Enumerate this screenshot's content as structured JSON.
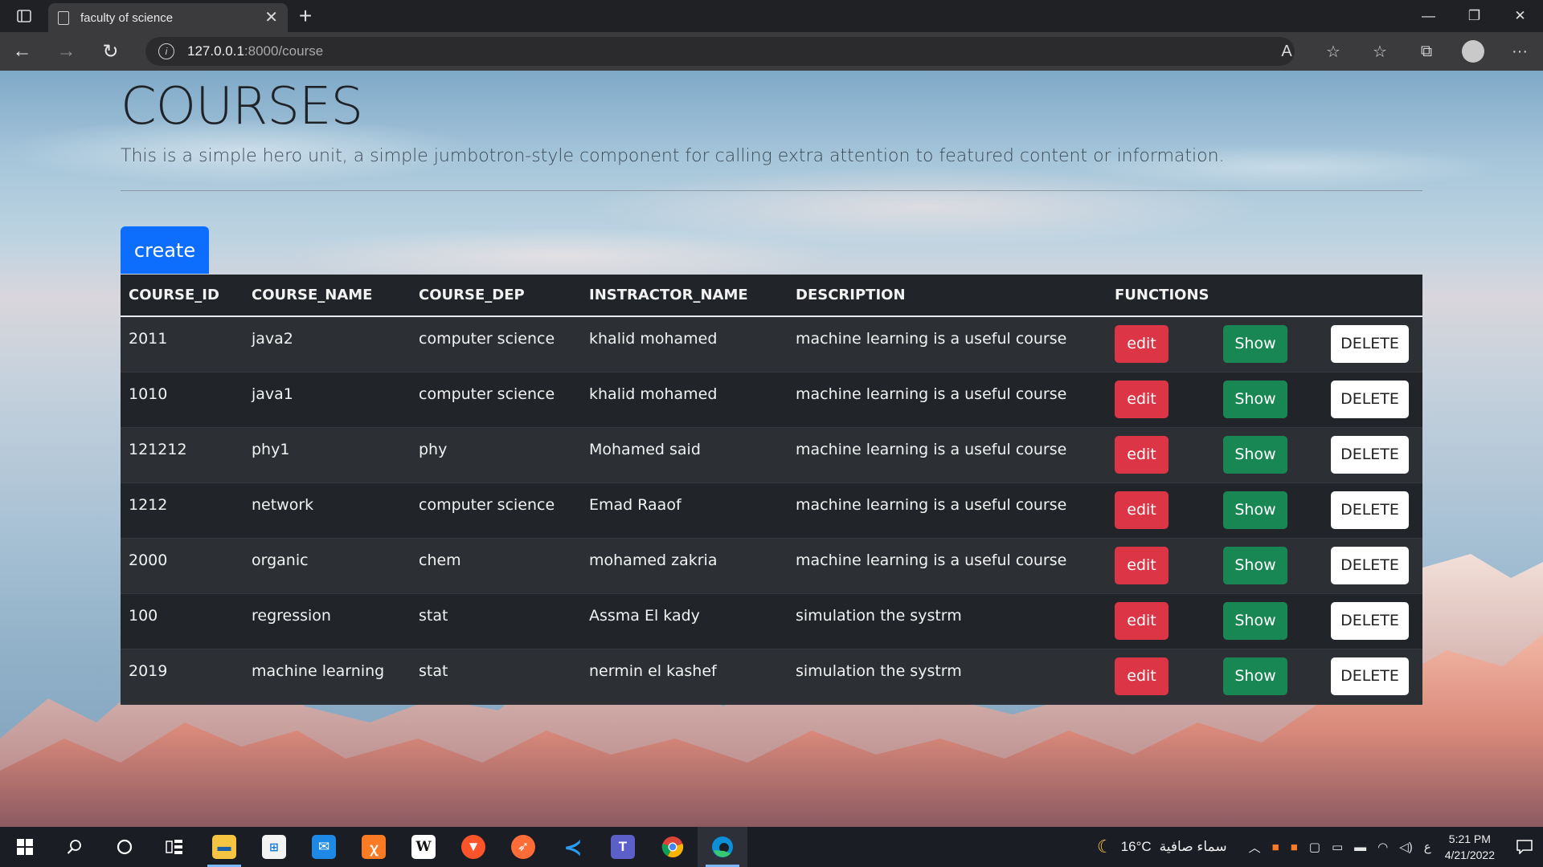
{
  "browser": {
    "tab_title": "faculty of science",
    "new_tab_label": "+",
    "url_host": "127.0.0.1",
    "url_port_path": ":8000/course",
    "window_controls": {
      "minimize": "—",
      "restore": "❐",
      "close": "✕"
    },
    "nav": {
      "back": "←",
      "forward": "→",
      "reload": "↻"
    },
    "toolbar_icons": {
      "read_aloud": "A",
      "favorite_add": "☆",
      "favorites": "☆",
      "collections": "⧉",
      "more": "···"
    }
  },
  "hero": {
    "title": "COURSES",
    "lead": "This is a simple hero unit, a simple jumbotron-style component for calling extra attention to featured content or information."
  },
  "create_label": "create",
  "table": {
    "headers": [
      "COURSE_ID",
      "COURSE_NAME",
      "COURSE_DEP",
      "INSTRACTOR_NAME",
      "DESCRIPTION",
      "FUNCTIONS"
    ],
    "edit_label": "edit",
    "show_label": "Show",
    "delete_label": "DELETE",
    "rows": [
      {
        "id": "2011",
        "name": "java2",
        "dep": "computer science",
        "instructor": "khalid mohamed",
        "description": "machine learning is a useful course"
      },
      {
        "id": "1010",
        "name": "java1",
        "dep": "computer science",
        "instructor": "khalid mohamed",
        "description": "machine learning is a useful course"
      },
      {
        "id": "121212",
        "name": "phy1",
        "dep": "phy",
        "instructor": "Mohamed said",
        "description": "machine learning is a useful course"
      },
      {
        "id": "1212",
        "name": "network",
        "dep": "computer science",
        "instructor": "Emad Raaof",
        "description": "machine learning is a useful course"
      },
      {
        "id": "2000",
        "name": "organic",
        "dep": "chem",
        "instructor": "mohamed zakria",
        "description": "machine learning is a useful course"
      },
      {
        "id": "100",
        "name": "regression",
        "dep": "stat",
        "instructor": "Assma El kady",
        "description": "simulation the systrm"
      },
      {
        "id": "2019",
        "name": "machine learning",
        "dep": "stat",
        "instructor": "nermin el kashef",
        "description": "simulation the systrm"
      }
    ]
  },
  "taskbar": {
    "apps": [
      "start",
      "search",
      "cortana",
      "task-view",
      "file-explorer",
      "microsoft-store",
      "mail",
      "xampp",
      "wikipedia",
      "brave",
      "postman",
      "vscode",
      "teams",
      "chrome",
      "edge"
    ],
    "weather_temp": "16°C",
    "weather_text": "سماء صافية",
    "language": "ع",
    "time": "5:21 PM",
    "date": "4/21/2022"
  },
  "colors": {
    "primary": "#0d6efd",
    "danger": "#dc3545",
    "success": "#198754",
    "table_dark": "#212529"
  }
}
